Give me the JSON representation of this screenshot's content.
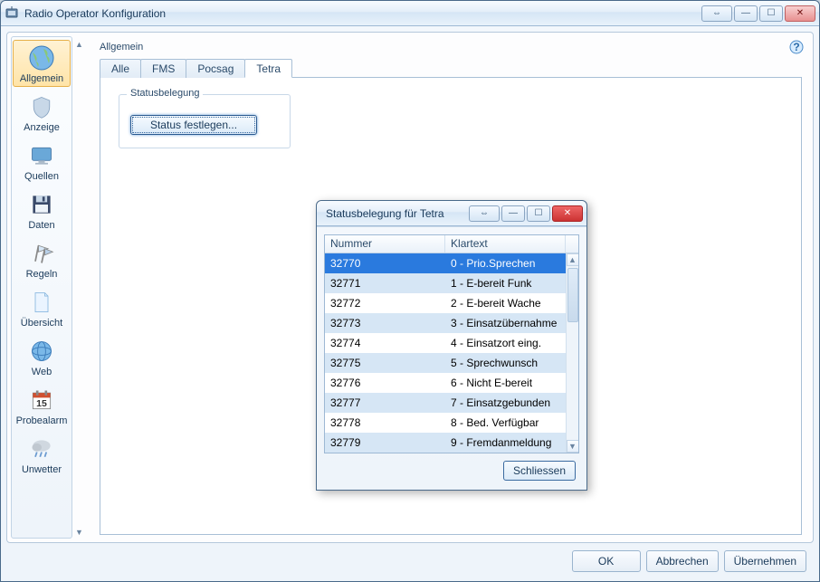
{
  "window": {
    "title": "Radio Operator Konfiguration"
  },
  "sidebar": {
    "items": [
      {
        "label": "Allgemein"
      },
      {
        "label": "Anzeige"
      },
      {
        "label": "Quellen"
      },
      {
        "label": "Daten"
      },
      {
        "label": "Regeln"
      },
      {
        "label": "Übersicht"
      },
      {
        "label": "Web"
      },
      {
        "label": "Probealarm"
      },
      {
        "label": "Unwetter"
      }
    ]
  },
  "content": {
    "header": "Allgemein",
    "tabs": {
      "alle": "Alle",
      "fms": "FMS",
      "pocsag": "Pocsag",
      "tetra": "Tetra"
    },
    "groupbox_legend": "Statusbelegung",
    "status_button": "Status festlegen..."
  },
  "dialog": {
    "title": "Statusbelegung für Tetra",
    "col_nummer": "Nummer",
    "col_klartext": "Klartext",
    "rows": [
      {
        "nummer": "32770",
        "klartext": "0 - Prio.Sprechen"
      },
      {
        "nummer": "32771",
        "klartext": "1 - E-bereit Funk"
      },
      {
        "nummer": "32772",
        "klartext": "2 - E-bereit Wache"
      },
      {
        "nummer": "32773",
        "klartext": "3 - Einsatzübernahme"
      },
      {
        "nummer": "32774",
        "klartext": "4 - Einsatzort eing."
      },
      {
        "nummer": "32775",
        "klartext": "5 - Sprechwunsch"
      },
      {
        "nummer": "32776",
        "klartext": "6 - Nicht E-bereit"
      },
      {
        "nummer": "32777",
        "klartext": "7 - Einsatzgebunden"
      },
      {
        "nummer": "32778",
        "klartext": "8 - Bed. Verfügbar"
      },
      {
        "nummer": "32779",
        "klartext": "9 - Fremdanmeldung"
      }
    ],
    "close_button": "Schliessen"
  },
  "footer": {
    "ok": "OK",
    "cancel": "Abbrechen",
    "apply": "Übernehmen"
  }
}
